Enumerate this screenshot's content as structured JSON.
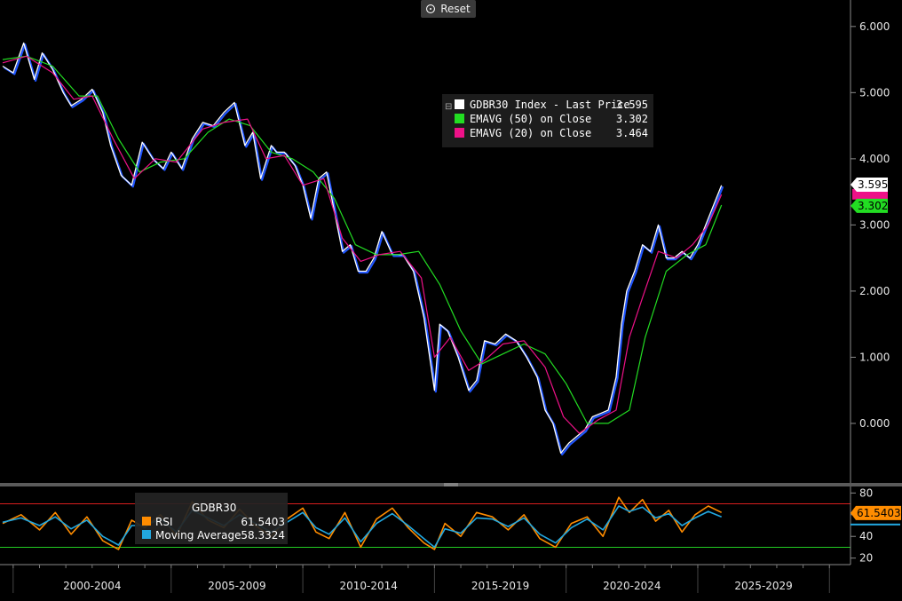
{
  "toolbar": {
    "reset_label": "Reset"
  },
  "legend_main": [
    {
      "label": "GDBR30 Index - Last Price",
      "value": "3.595",
      "color": "#ffffff"
    },
    {
      "label": "EMAVG (50)  on Close",
      "value": "3.302",
      "color": "#22dd22"
    },
    {
      "label": "EMAVG (20)  on Close",
      "value": "3.464",
      "color": "#ee1188"
    }
  ],
  "legend_rsi": {
    "title": "GDBR30",
    "items": [
      {
        "label": "RSI",
        "value": "61.5403",
        "color": "#ff8c00"
      },
      {
        "label": "Moving Average",
        "value": "58.3324",
        "color": "#22a8e0"
      }
    ]
  },
  "price_tags": [
    {
      "value": "3.595",
      "bg": "#ffffff",
      "fg": "#000000"
    },
    {
      "value": "3.302",
      "bg": "#22dd22",
      "fg": "#000000"
    }
  ],
  "rsi_tag": {
    "value": "61.5403",
    "bg": "#ff8c00",
    "fg": "#000000"
  },
  "chart_data": [
    {
      "type": "line",
      "xlim": [
        1998.5,
        2030.8
      ],
      "ylim": [
        -0.9,
        6.4
      ],
      "yticks": [
        "6.000",
        "5.000",
        "4.000",
        "3.000",
        "2.000",
        "1.000",
        "0.000"
      ],
      "ytick_values": [
        6,
        5,
        4,
        3,
        2,
        1,
        0
      ],
      "period_labels": [
        "2000-2004",
        "2005-2009",
        "2010-2014",
        "2015-2019",
        "2020-2024",
        "2025-2029"
      ],
      "period_starts": [
        1999,
        2005,
        2010,
        2015,
        2020,
        2025,
        2030
      ],
      "series": [
        {
          "name": "GDBR30 Index - Last Price",
          "color": "#ffffff",
          "x": [
            1998.6,
            1999.0,
            1999.4,
            1999.8,
            2000.1,
            2000.5,
            2000.9,
            2001.2,
            2001.6,
            2002.0,
            2002.4,
            2002.7,
            2003.1,
            2003.5,
            2003.9,
            2004.3,
            2004.7,
            2005.0,
            2005.4,
            2005.8,
            2006.2,
            2006.6,
            2007.0,
            2007.4,
            2007.8,
            2008.1,
            2008.4,
            2008.8,
            2009.0,
            2009.3,
            2009.7,
            2010.0,
            2010.3,
            2010.6,
            2010.9,
            2011.2,
            2011.5,
            2011.8,
            2012.1,
            2012.4,
            2012.7,
            2013.0,
            2013.4,
            2013.8,
            2014.2,
            2014.6,
            2015.0,
            2015.2,
            2015.5,
            2015.9,
            2016.3,
            2016.6,
            2016.9,
            2017.3,
            2017.7,
            2018.1,
            2018.5,
            2018.9,
            2019.2,
            2019.5,
            2019.8,
            2020.1,
            2020.4,
            2020.7,
            2021.0,
            2021.3,
            2021.6,
            2021.9,
            2022.1,
            2022.3,
            2022.6,
            2022.9,
            2023.2,
            2023.5,
            2023.8,
            2024.1,
            2024.4,
            2024.7,
            2025.0,
            2025.3,
            2025.6,
            2025.9
          ],
          "values": [
            5.4,
            5.3,
            5.75,
            5.2,
            5.6,
            5.35,
            5.0,
            4.8,
            4.9,
            5.05,
            4.7,
            4.2,
            3.75,
            3.6,
            4.25,
            4.0,
            3.85,
            4.1,
            3.85,
            4.3,
            4.55,
            4.5,
            4.7,
            4.85,
            4.2,
            4.4,
            3.7,
            4.2,
            4.1,
            4.1,
            3.9,
            3.6,
            3.1,
            3.7,
            3.8,
            3.2,
            2.6,
            2.7,
            2.3,
            2.3,
            2.5,
            2.9,
            2.55,
            2.55,
            2.3,
            1.6,
            0.5,
            1.5,
            1.4,
            1.0,
            0.5,
            0.65,
            1.25,
            1.2,
            1.35,
            1.25,
            1.0,
            0.7,
            0.2,
            0.0,
            -0.45,
            -0.3,
            -0.2,
            -0.1,
            0.1,
            0.15,
            0.2,
            0.7,
            1.5,
            2.0,
            2.3,
            2.7,
            2.6,
            3.0,
            2.5,
            2.5,
            2.6,
            2.5,
            2.7,
            3.0,
            3.3,
            3.6
          ]
        },
        {
          "name": "EMAVG (50)  on Close",
          "color": "#22dd22",
          "x": [
            1998.6,
            1999.5,
            2000.5,
            2001.5,
            2002.2,
            2003.0,
            2003.8,
            2004.6,
            2005.5,
            2006.4,
            2007.2,
            2008.0,
            2008.8,
            2009.6,
            2010.4,
            2011.2,
            2012.0,
            2012.8,
            2013.6,
            2014.4,
            2015.2,
            2016.0,
            2016.8,
            2017.6,
            2018.4,
            2019.2,
            2020.0,
            2020.8,
            2021.6,
            2022.4,
            2023.0,
            2023.8,
            2024.6,
            2025.3,
            2025.9
          ],
          "values": [
            5.5,
            5.55,
            5.4,
            4.95,
            4.95,
            4.3,
            3.8,
            3.95,
            4.0,
            4.4,
            4.6,
            4.5,
            4.1,
            4.0,
            3.8,
            3.4,
            2.7,
            2.55,
            2.55,
            2.6,
            2.1,
            1.4,
            0.9,
            1.05,
            1.2,
            1.05,
            0.6,
            0.0,
            0.0,
            0.2,
            1.3,
            2.3,
            2.55,
            2.7,
            3.3
          ]
        },
        {
          "name": "EMAVG (20)  on Close",
          "color": "#ee1188",
          "x": [
            1998.6,
            1999.5,
            2000.5,
            2001.3,
            2002.0,
            2002.8,
            2003.6,
            2004.4,
            2005.2,
            2006.2,
            2007.0,
            2007.9,
            2008.6,
            2009.3,
            2010.0,
            2010.8,
            2011.5,
            2012.2,
            2012.9,
            2013.7,
            2014.5,
            2015.0,
            2015.6,
            2016.3,
            2016.9,
            2017.6,
            2018.4,
            2019.2,
            2019.9,
            2020.5,
            2021.2,
            2021.9,
            2022.4,
            2022.9,
            2023.5,
            2024.2,
            2024.8,
            2025.4,
            2025.9
          ],
          "values": [
            5.45,
            5.55,
            5.3,
            4.9,
            4.95,
            4.3,
            3.7,
            4.0,
            3.95,
            4.45,
            4.55,
            4.6,
            4.0,
            4.05,
            3.6,
            3.7,
            2.8,
            2.45,
            2.55,
            2.6,
            2.2,
            1.0,
            1.3,
            0.8,
            0.95,
            1.2,
            1.25,
            0.85,
            0.1,
            -0.15,
            0.05,
            0.2,
            1.3,
            1.9,
            2.6,
            2.5,
            2.7,
            3.0,
            3.46
          ]
        }
      ]
    },
    {
      "type": "line",
      "ylim": [
        14,
        86
      ],
      "yticks": [
        "80",
        "60",
        "40",
        "20"
      ],
      "ytick_values": [
        80,
        60,
        40,
        20
      ],
      "ref_lines": [
        70,
        30
      ],
      "series": [
        {
          "name": "RSI",
          "color": "#ff8c00",
          "x": [
            1998.6,
            1999.3,
            2000.0,
            2000.6,
            2001.2,
            2001.8,
            2002.4,
            2003.0,
            2003.5,
            2004.0,
            2004.6,
            2005.2,
            2005.8,
            2006.4,
            2007.0,
            2007.6,
            2008.2,
            2008.8,
            2009.4,
            2010.0,
            2010.5,
            2011.0,
            2011.6,
            2012.2,
            2012.8,
            2013.4,
            2014.0,
            2014.6,
            2015.0,
            2015.4,
            2016.0,
            2016.6,
            2017.2,
            2017.8,
            2018.4,
            2019.0,
            2019.6,
            2020.2,
            2020.8,
            2021.4,
            2022.0,
            2022.4,
            2022.9,
            2023.4,
            2023.9,
            2024.4,
            2024.9,
            2025.4,
            2025.9
          ],
          "values": [
            52,
            60,
            46,
            62,
            42,
            58,
            36,
            28,
            55,
            48,
            60,
            40,
            72,
            55,
            48,
            65,
            50,
            40,
            56,
            66,
            44,
            38,
            62,
            30,
            56,
            66,
            48,
            34,
            28,
            52,
            40,
            62,
            58,
            46,
            60,
            38,
            30,
            52,
            58,
            40,
            76,
            62,
            74,
            54,
            64,
            44,
            60,
            68,
            62
          ]
        },
        {
          "name": "Moving Average",
          "color": "#22a8e0",
          "x": [
            1998.6,
            1999.3,
            2000.0,
            2000.6,
            2001.2,
            2001.8,
            2002.4,
            2003.0,
            2003.5,
            2004.0,
            2004.6,
            2005.2,
            2005.8,
            2006.4,
            2007.0,
            2007.6,
            2008.2,
            2008.8,
            2009.4,
            2010.0,
            2010.5,
            2011.0,
            2011.6,
            2012.2,
            2012.8,
            2013.4,
            2014.0,
            2014.6,
            2015.0,
            2015.4,
            2016.0,
            2016.6,
            2017.2,
            2017.8,
            2018.4,
            2019.0,
            2019.6,
            2020.2,
            2020.8,
            2021.4,
            2022.0,
            2022.4,
            2022.9,
            2023.4,
            2023.9,
            2024.4,
            2024.9,
            2025.4,
            2025.9
          ],
          "values": [
            53,
            57,
            50,
            58,
            47,
            55,
            40,
            32,
            50,
            50,
            56,
            44,
            64,
            57,
            50,
            60,
            52,
            44,
            53,
            62,
            48,
            42,
            57,
            35,
            52,
            61,
            50,
            38,
            30,
            47,
            43,
            57,
            56,
            49,
            57,
            42,
            34,
            48,
            56,
            46,
            68,
            63,
            67,
            57,
            61,
            50,
            57,
            63,
            58
          ]
        }
      ]
    }
  ]
}
